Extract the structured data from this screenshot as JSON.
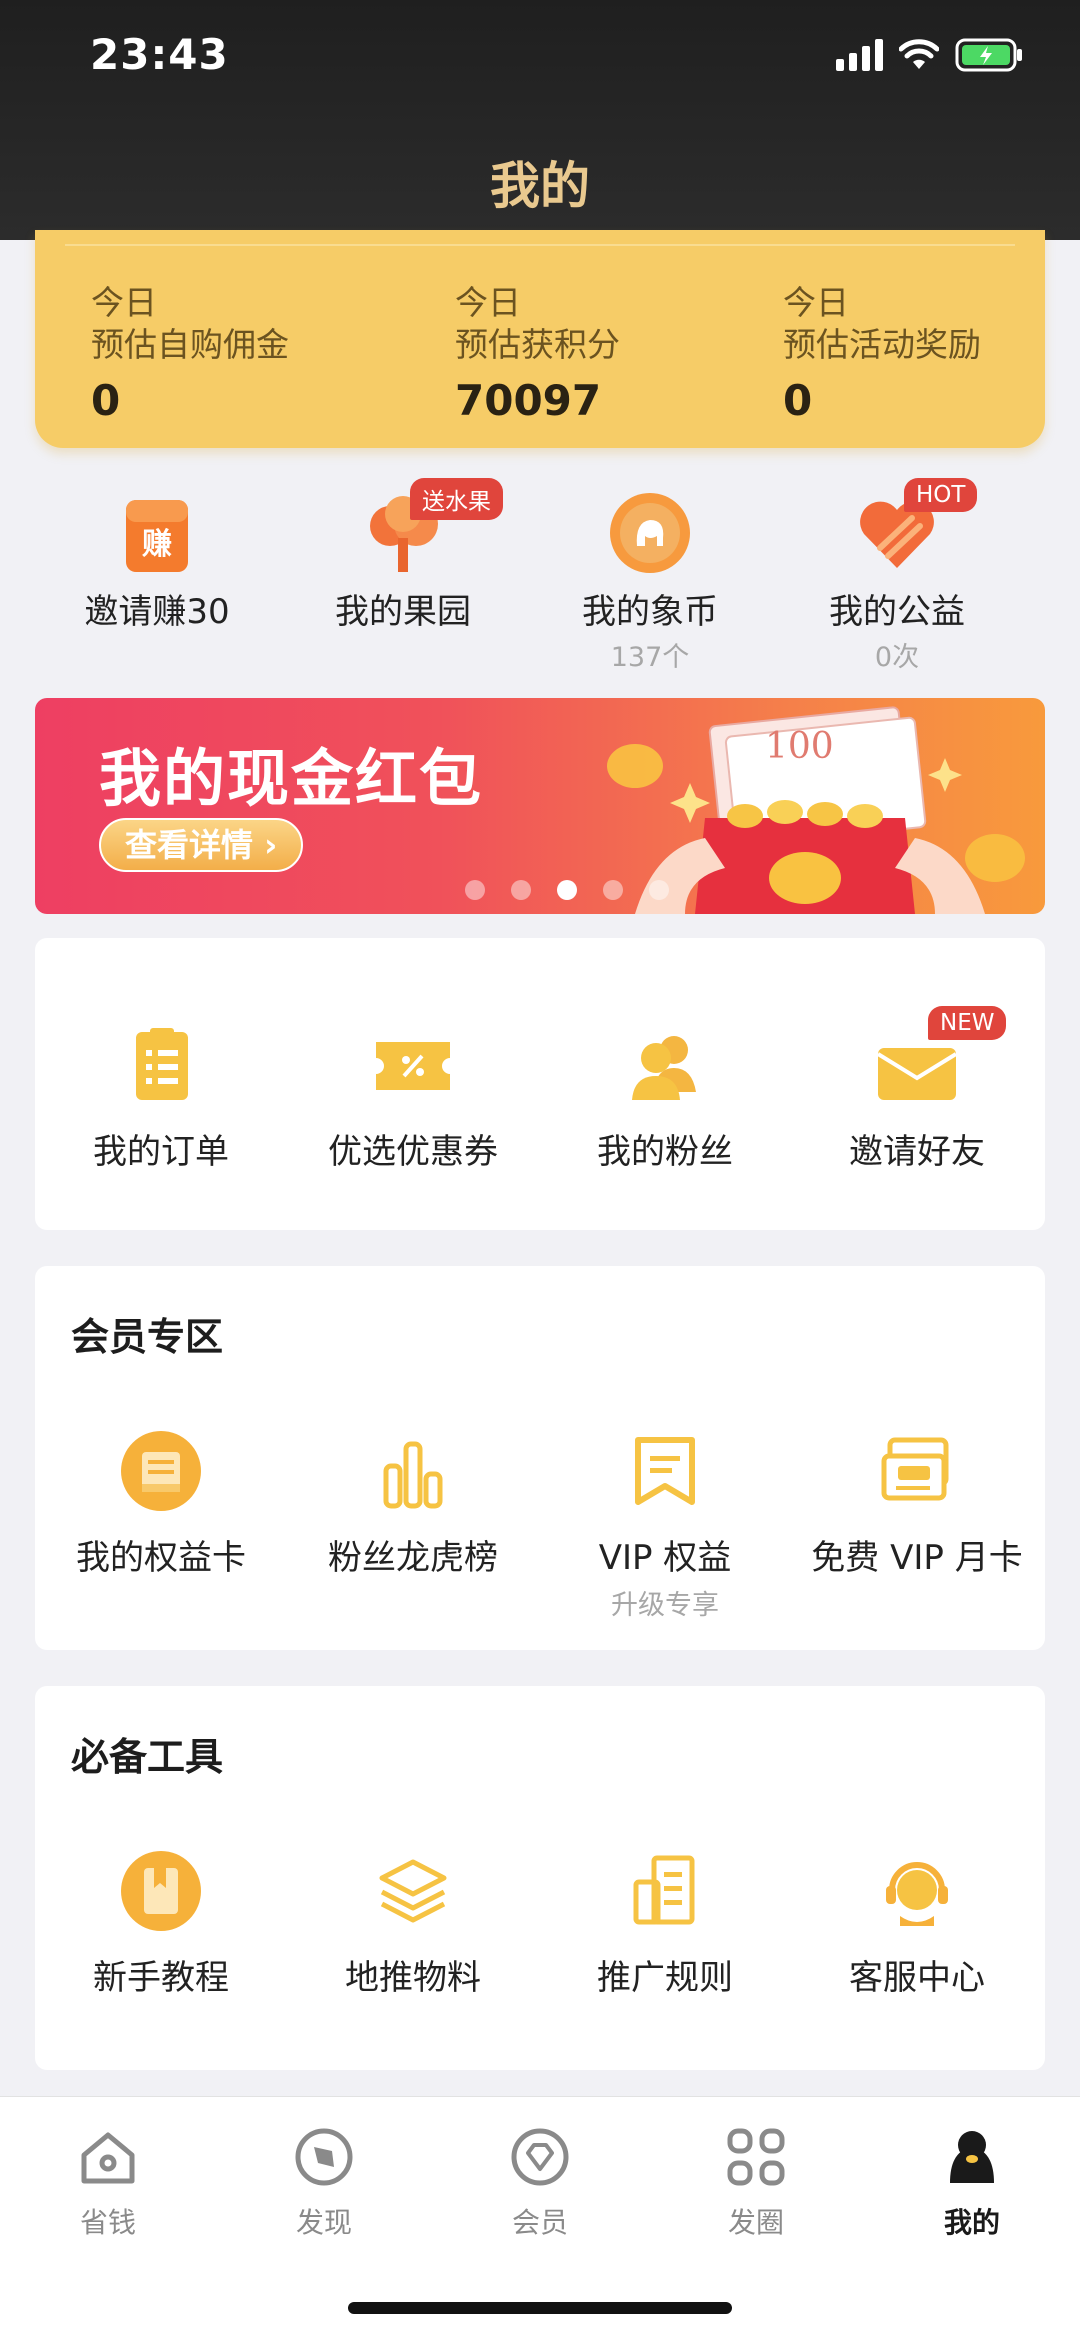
{
  "status_bar": {
    "time": "23:43"
  },
  "header": {
    "title": "我的"
  },
  "stats": [
    {
      "line1": "今日",
      "line2": "预估自购佣金",
      "value": "0"
    },
    {
      "line1": "今日",
      "line2": "预估获积分",
      "value": "70097"
    },
    {
      "line1": "今日",
      "line2": "预估活动奖励",
      "value": "0"
    }
  ],
  "quick": [
    {
      "label": "邀请赚30",
      "icon": "earn-icon"
    },
    {
      "label": "我的果园",
      "badge": "送水果",
      "icon": "fruit-tree-icon"
    },
    {
      "label": "我的象币",
      "sub": "137个",
      "icon": "elephant-coin-icon"
    },
    {
      "label": "我的公益",
      "sub": "0次",
      "badge": "HOT",
      "icon": "charity-heart-icon"
    }
  ],
  "banner": {
    "title": "我的现金红包",
    "button": "查看详情 ›",
    "bill_value": "100",
    "active_dot": 2,
    "dot_count": 5
  },
  "orders": [
    {
      "label": "我的订单",
      "icon": "order-list-icon"
    },
    {
      "label": "优选优惠券",
      "icon": "coupon-icon"
    },
    {
      "label": "我的粉丝",
      "icon": "fans-icon"
    },
    {
      "label": "邀请好友",
      "badge": "NEW",
      "icon": "invite-envelope-icon"
    }
  ],
  "member": {
    "title": "会员专区",
    "items": [
      {
        "label": "我的权益卡",
        "icon": "benefit-card-icon"
      },
      {
        "label": "粉丝龙虎榜",
        "icon": "ranking-bars-icon"
      },
      {
        "label": "VIP 权益",
        "sub": "升级专享",
        "icon": "vip-flag-icon"
      },
      {
        "label": "免费 VIP 月卡",
        "icon": "vip-card-icon"
      }
    ]
  },
  "tools": {
    "title": "必备工具",
    "items": [
      {
        "label": "新手教程",
        "icon": "tutorial-book-icon"
      },
      {
        "label": "地推物料",
        "icon": "layers-icon"
      },
      {
        "label": "推广规则",
        "icon": "rules-doc-icon"
      },
      {
        "label": "客服中心",
        "icon": "customer-service-icon"
      }
    ]
  },
  "tabbar": [
    {
      "label": "省钱",
      "icon": "home-icon"
    },
    {
      "label": "发现",
      "icon": "compass-icon"
    },
    {
      "label": "会员",
      "icon": "diamond-icon"
    },
    {
      "label": "发圈",
      "icon": "grid-icon"
    },
    {
      "label": "我的",
      "icon": "profile-icon",
      "active": true
    }
  ],
  "colors": {
    "accent": "#F6C343",
    "header": "#242424",
    "title_gold": "#E9C98F",
    "badge_red": "#E0453C",
    "banner_pink": "#EE3F62"
  }
}
